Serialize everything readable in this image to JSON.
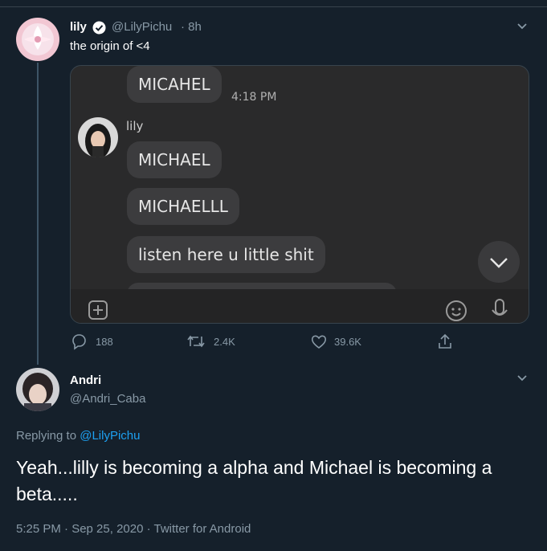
{
  "tweet": {
    "author_name": "lily",
    "author_handle": "@LilyPichu",
    "time_ago": "· 8h",
    "text": "the origin of <4",
    "media": {
      "messages": [
        {
          "text": "MICAHEL"
        },
        {
          "text": "MICHAEL"
        },
        {
          "text": "MICHAELLL"
        },
        {
          "text": "listen here u little shit"
        }
      ],
      "timestamp": "4:18 PM",
      "sender_label": "lily"
    },
    "actions": {
      "replies": "188",
      "retweets": "2.4K",
      "likes": "39.6K"
    }
  },
  "reply": {
    "author_name": "Andri",
    "author_handle": "@Andri_Caba",
    "replying_prefix": "Replying to",
    "replying_to": "@LilyPichu",
    "text": "Yeah...lilly is becoming a alpha and Michael is becoming a beta.....",
    "meta": "5:25 PM · Sep 25, 2020 · Twitter for Android"
  },
  "colors": {
    "background": "#15202b",
    "secondary_text": "#8899a6",
    "link": "#1da1f2",
    "divider": "#38444d"
  },
  "icons": [
    "verified-badge-icon",
    "chevron-down-icon",
    "reply-icon",
    "retweet-icon",
    "like-icon",
    "share-icon",
    "add-icon",
    "emoji-icon",
    "mic-icon"
  ]
}
